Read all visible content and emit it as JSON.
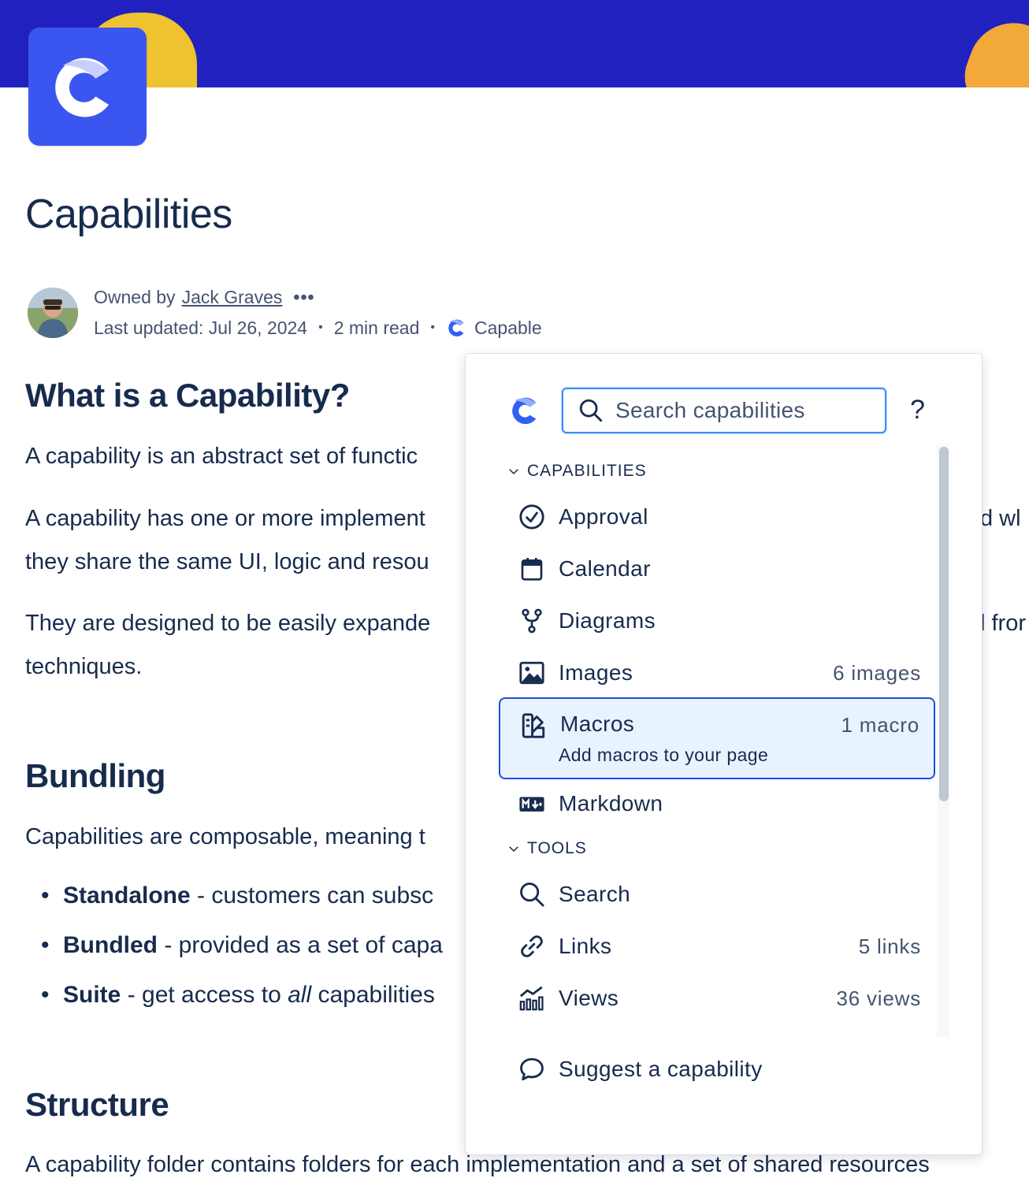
{
  "page": {
    "title": "Capabilities",
    "byline": {
      "owned_by_prefix": "Owned by",
      "owner": "Jack Graves",
      "more": "•••",
      "last_updated": "Last updated: Jul 26, 2024",
      "read_time": "2 min read",
      "app_name": "Capable"
    }
  },
  "article": {
    "h_what": "What is a Capability?",
    "p1": "A capability is an abstract set of functic",
    "p2a": "A capability has one or more implement",
    "p2b": "they share the same UI, logic and resou",
    "p2c": "d wl",
    "p3a": "They are designed to be easily expande",
    "p3b": "techniques.",
    "p3c": "l fror",
    "h_bundling": "Bundling",
    "p4": "Capabilities are composable, meaning t",
    "bullets": [
      {
        "bold": "Standalone",
        "rest": " - customers can subsc"
      },
      {
        "bold": "Bundled",
        "rest": " - provided as a set of capa"
      },
      {
        "bold": "Suite",
        "mid": " - get access to ",
        "italic": "all",
        "rest": " capabilities"
      }
    ],
    "h_structure": "Structure",
    "p5": "A capability folder contains folders for each implementation and a set of shared resources"
  },
  "popup": {
    "search_placeholder": "Search capabilities",
    "help": "?",
    "sections": {
      "capabilities": "CAPABILITIES",
      "tools": "TOOLS"
    },
    "capabilities": [
      {
        "label": "Approval",
        "icon": "check-circle-icon",
        "count": ""
      },
      {
        "label": "Calendar",
        "icon": "calendar-icon",
        "count": ""
      },
      {
        "label": "Diagrams",
        "icon": "diagram-icon",
        "count": ""
      },
      {
        "label": "Images",
        "icon": "image-icon",
        "count": "6 images"
      },
      {
        "label": "Macros",
        "icon": "macro-icon",
        "count": "1 macro",
        "subtitle": "Add macros to your page",
        "selected": true
      },
      {
        "label": "Markdown",
        "icon": "markdown-icon",
        "count": ""
      }
    ],
    "tools": [
      {
        "label": "Search",
        "icon": "search-icon",
        "count": ""
      },
      {
        "label": "Links",
        "icon": "link-icon",
        "count": "5 links"
      },
      {
        "label": "Views",
        "icon": "views-icon",
        "count": "36 views"
      }
    ],
    "suggest": "Suggest a capability"
  },
  "colors": {
    "banner": "#2121bf",
    "accent": "#3b56f0",
    "text": "#172b4d",
    "selected_bg": "#e9f2ff",
    "selected_border": "#1d4ed8"
  }
}
